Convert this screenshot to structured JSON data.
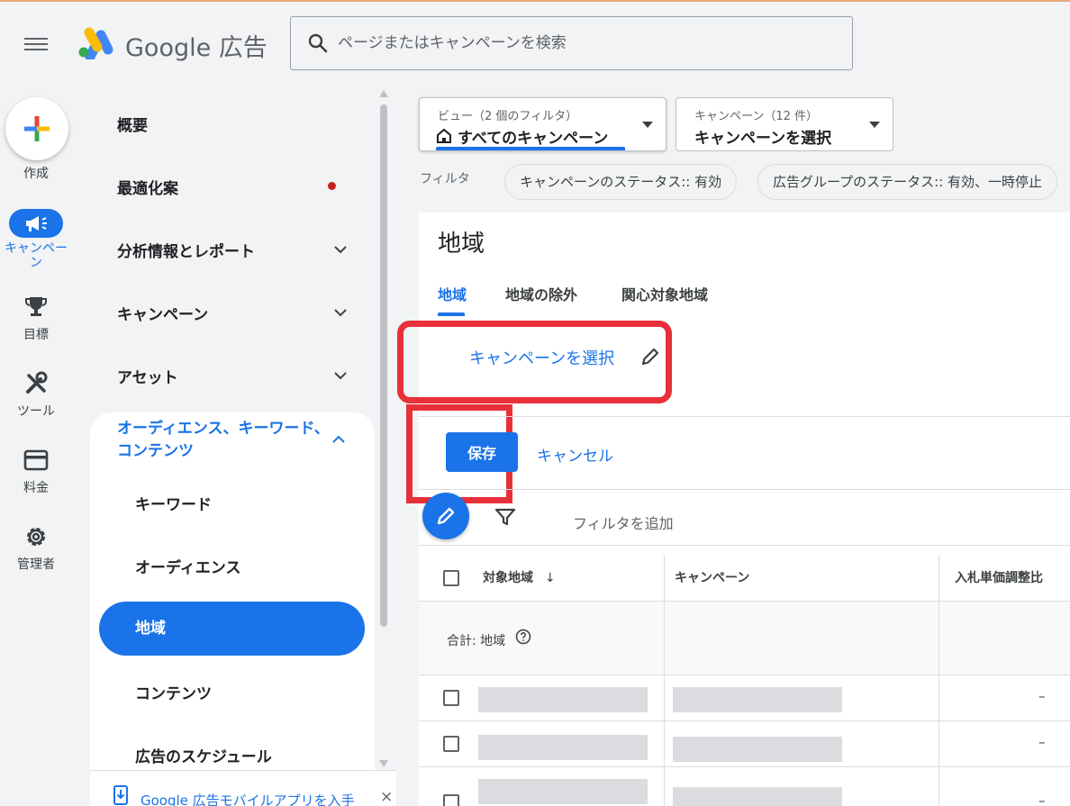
{
  "header": {
    "brand_google": "Google",
    "brand_product": "広告",
    "search_placeholder": "ページまたはキャンペーンを検索",
    "menu_icon": "hamburger-icon",
    "search_icon": "search-icon"
  },
  "rail": {
    "create_label": "作成",
    "campaigns_label": "キャンペーン",
    "goals_label": "目標",
    "tools_label": "ツール",
    "billing_label": "料金",
    "admin_label": "管理者"
  },
  "nav": {
    "overview": "概要",
    "recommendations": "最適化案",
    "insights": "分析情報とレポート",
    "campaigns": "キャンペーン",
    "assets": "アセット",
    "audiences_group": "オーディエンス、キーワード、コンテンツ",
    "sub_items": {
      "keywords": "キーワード",
      "audiences": "オーディエンス",
      "locations": "地域",
      "content": "コンテンツ",
      "ad_schedule": "広告のスケジュール"
    },
    "app_banner": "Google 広告モバイルアプリを入手",
    "close_glyph": "×"
  },
  "toolbar": {
    "view_label": "ビュー（2 個のフィルタ）",
    "view_value": "すべてのキャンペーン",
    "campaign_label": "キャンペーン（12 件）",
    "campaign_value": "キャンペーンを選択",
    "filter_label": "フィルタ",
    "chips": [
      "キャンペーンのステータス:: 有効",
      "広告グループのステータス:: 有効、一時停止"
    ]
  },
  "panel": {
    "title": "地域",
    "tabs": [
      "地域",
      "地域の除外",
      "関心対象地域"
    ],
    "select_campaign": "キャンペーンを選択",
    "save": "保存",
    "cancel": "キャンセル",
    "add_filter": "フィルタを追加"
  },
  "table": {
    "columns": [
      "対象地域",
      "キャンペーン",
      "入札単価調整比"
    ],
    "sort_glyph": "↓",
    "total_label": "合計: 地域",
    "empty_value": "–"
  },
  "colors": {
    "accent": "#1a73e8",
    "highlight": "#e8303a",
    "recommendation_dot": "#c5221f"
  }
}
